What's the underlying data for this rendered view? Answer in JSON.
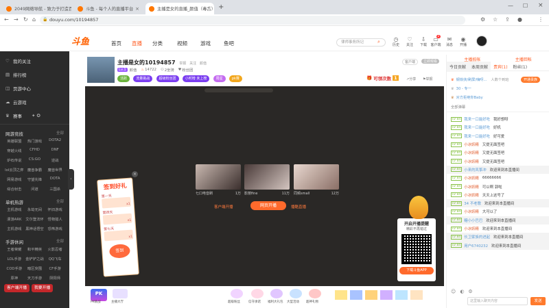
{
  "browser": {
    "tabs": [
      "2049网络导航 - 致力于打造百年...",
      "斗鱼 - 每个人的直播平台",
      "主播是女的直播_颜值（毒舌）直播..."
    ],
    "url": "douyu.com/10194857"
  },
  "header": {
    "logo": "斗鱼",
    "nav": [
      "首页",
      "直播",
      "分类",
      "视频",
      "游戏",
      "鱼吧"
    ],
    "search_placeholder": "律师事务所记",
    "icons": [
      {
        "name": "history",
        "label": "历史"
      },
      {
        "name": "follow",
        "label": "关注"
      },
      {
        "name": "upload",
        "label": "下载"
      },
      {
        "name": "message",
        "label": "客户端"
      },
      {
        "name": "mail",
        "label": "消息"
      },
      {
        "name": "live",
        "label": "开播"
      }
    ],
    "msg_badge": "2"
  },
  "sidebar": {
    "items": [
      "我的关注",
      "排行榜",
      "页游中心",
      "云游戏",
      "赛事"
    ],
    "sections": [
      {
        "title": "网游竞技",
        "more": "全部",
        "games": [
          "英雄联盟",
          "热门游戏",
          "DOTA2",
          "穿越火线",
          "CFHD",
          "DNF",
          "炉石传说",
          "CS:GO",
          "逆战",
          "lol云顶之弈",
          "魔兽争霸",
          "魔兽世界",
          "网易游戏",
          "守望先锋",
          "DOTA",
          "综合射击",
          "问道",
          "三国杀"
        ]
      },
      {
        "title": "单机热游",
        "more": "全部",
        "games": [
          "主机游戏",
          "永劫无间",
          "怀旧游戏",
          "漫游ARK",
          "艾尔登法环",
          "怪物猎人",
          "主机游戏",
          "黑神话悟空",
          "恐怖游戏"
        ]
      },
      {
        "title": "手游休闲",
        "more": "全部",
        "games": [
          "王者荣耀",
          "和平精英",
          "火影忍者",
          "LOL手游",
          "金铲铲之战",
          "QQ飞车",
          "COD手游",
          "暗区突围",
          "CF手游",
          "原神",
          "天刀手游",
          "阴阳师"
        ]
      }
    ],
    "buttons": [
      "客户端开播",
      "我要开播"
    ]
  },
  "stream": {
    "title": "主播是女的10194857",
    "tags_text": [
      "举报",
      "关注",
      "颜值"
    ],
    "level_badge": "Lv.1",
    "category_label": "颜值",
    "heat": "14722",
    "followers": "2坐骑",
    "fans_label": "粉丝团",
    "pill_tags": [
      "活跃",
      "流量挑战",
      "超级粉丝团",
      "小时榜 未上榜",
      "周星",
      "pk赛"
    ],
    "share_label": "分享",
    "report_label": "举报",
    "client_label": "客户端",
    "watch_label": "立即观看",
    "sign_label": "可领次数",
    "sign_count": "1"
  },
  "player": {
    "signin": {
      "title": "签到好礼",
      "days": [
        "第一天",
        "第四天",
        "第七天"
      ],
      "rewards": [
        "x1",
        "x1",
        "x1"
      ],
      "btn": "签到"
    },
    "cards": [
      {
        "caption": "七口电音刷",
        "count": "1万"
      },
      {
        "caption": "影丽fine",
        "count": "11万"
      },
      {
        "caption": "同频small",
        "count": "12万"
      }
    ],
    "links": [
      "客户端开播",
      "网页开播",
      "播酷直播"
    ],
    "qr": {
      "title": "开启开播提醒",
      "subtitle": "精彩不再错过",
      "btn": "下载斗鱼APP"
    }
  },
  "toolbar": {
    "pk_label": "PK",
    "gift_labels": [
      "PK挑战",
      "主播大厅",
      "超级粉丝",
      "信守承诺",
      "福利大礼包",
      "大型活动",
      "超神礼物"
    ]
  },
  "rpanel": {
    "tabs1": [
      "主播抵帐",
      "主播回帐"
    ],
    "tabs2": [
      "今日贡献",
      "本周贡献",
      "贵宾(1)",
      "粉丝(1)"
    ],
    "fan_btn": "开通贵族",
    "top_users": [
      {
        "name": "钢铁侠/刷屏/嗨呀...",
        "note": "人数个到班"
      },
      {
        "name": "30 - 专一",
        "note": ""
      },
      {
        "name": "对方拒绝你Baby",
        "note": ""
      }
    ],
    "chat_header": "全部弹幕",
    "chats": [
      {
        "lv": "LV 84",
        "name": "我来一口能好吃",
        "msg": "我好想呀"
      },
      {
        "lv": "LV 84",
        "name": "我来一口能好吃",
        "msg": "好机"
      },
      {
        "lv": "LV 84",
        "name": "我来一口能好吃",
        "msg": "好可爱"
      },
      {
        "lv": "LV 84",
        "name": "小冰妖精",
        "msg": "又提无面签吧"
      },
      {
        "lv": "LV 84",
        "name": "小冰妖精",
        "msg": "又提无面签吧"
      },
      {
        "lv": "LV 84",
        "name": "小冰妖精",
        "msg": "又提无面签吧"
      },
      {
        "lv": "LV 84",
        "name": "小来的风筝冲",
        "msg": "欢迎来到本直播间"
      },
      {
        "lv": "LV 84",
        "name": "小冰妖精",
        "msg": "66666666"
      },
      {
        "lv": "LV 84",
        "name": "小冰妖精",
        "msg": "可以啊 郭啦"
      },
      {
        "lv": "LV 84",
        "name": "小冰妖精",
        "msg": "天天上这号了"
      },
      {
        "lv": "LV 84",
        "name": "34 不老歌",
        "msg": "欢迎来到本直播间"
      },
      {
        "lv": "LV 84",
        "name": "小冰妖精",
        "msg": "大可以了"
      },
      {
        "lv": "LV 84",
        "name": "糖小小巴巴",
        "msg": "欢迎来到本直播间"
      },
      {
        "lv": "LV 84",
        "name": "小冰妖精",
        "msg": "欢迎来到本直播间"
      },
      {
        "lv": "LV 84",
        "name": "长卫家族的进起",
        "msg": "欢迎来到本直播间"
      },
      {
        "lv": "LV 84",
        "name": "用户6740232",
        "msg": "欢迎来到本直播间"
      }
    ],
    "input_placeholder": "这里输入聊天内容",
    "send_label": "发送"
  }
}
